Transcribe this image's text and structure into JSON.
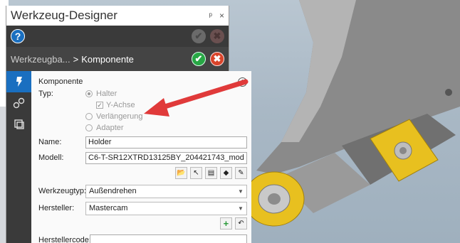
{
  "panel": {
    "title": "Werkzeug-Designer",
    "pin_label": "ᵖ",
    "close_label": "×"
  },
  "help_bar": {
    "help_label": "?"
  },
  "breadcrumb": {
    "parent": "Werkzeugba...",
    "separator": ">",
    "current": "Komponente"
  },
  "side_tabs": [
    {
      "icon": "tool-icon"
    },
    {
      "icon": "links-icon"
    },
    {
      "icon": "layers-icon"
    }
  ],
  "section": {
    "title": "Komponente"
  },
  "type": {
    "label": "Typ:",
    "options": [
      "Halter",
      "Verlängerung",
      "Adapter"
    ],
    "selected": "Halter",
    "y_axis_label": "Y-Achse"
  },
  "fields": {
    "name_label": "Name:",
    "name_value": "Holder",
    "model_label": "Modell:",
    "model_value": "C6-T-SR12XTRD13125BY_204421743_mod",
    "tool_type_label": "Werkzeugtyp:",
    "tool_type_value": "Außendrehen",
    "manufacturer_label": "Hersteller:",
    "manufacturer_value": "Mastercam",
    "manufacturer_code_label": "Herstellercode:",
    "manufacturer_code_value": ""
  },
  "colors": {
    "accent": "#1a6fc0",
    "ok": "#28a745",
    "cancel": "#d9442a",
    "arrow": "#e03a3a",
    "insert": "#e8c01f"
  }
}
